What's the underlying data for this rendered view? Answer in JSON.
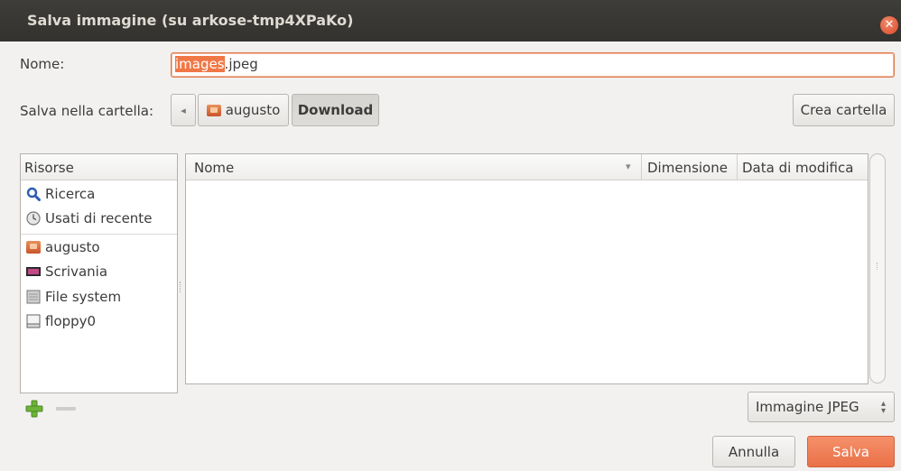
{
  "window": {
    "title": "Salva immagine (su arkose-tmp4XPaKo)"
  },
  "form": {
    "name_label": "Nome:",
    "name_selected": "images",
    "name_rest": ".jpeg",
    "folder_label": "Salva nella cartella:",
    "back_arrow": "◂",
    "path": [
      {
        "label": "augusto"
      },
      {
        "label": "Download"
      }
    ],
    "create_folder": "Crea cartella"
  },
  "places": {
    "header": "Risorse",
    "items": [
      {
        "label": "Ricerca",
        "icon": "search-icon"
      },
      {
        "label": "Usati di recente",
        "icon": "recent-icon"
      },
      {
        "label": "augusto",
        "icon": "home-folder-icon"
      },
      {
        "label": "Scrivania",
        "icon": "desktop-icon"
      },
      {
        "label": "File system",
        "icon": "drive-icon"
      },
      {
        "label": "floppy0",
        "icon": "floppy-icon"
      }
    ],
    "add_symbol": "+",
    "remove_symbol": "—"
  },
  "files": {
    "columns": [
      "Nome",
      "Dimensione",
      "Data di modifica"
    ],
    "sort_arrow": "▾"
  },
  "filter": {
    "selected": "Immagine JPEG",
    "arrows": "⌃⌄"
  },
  "actions": {
    "cancel": "Annulla",
    "save": "Salva"
  },
  "colors": {
    "accent": "#f07746",
    "titlebar": "#3c3b37"
  }
}
